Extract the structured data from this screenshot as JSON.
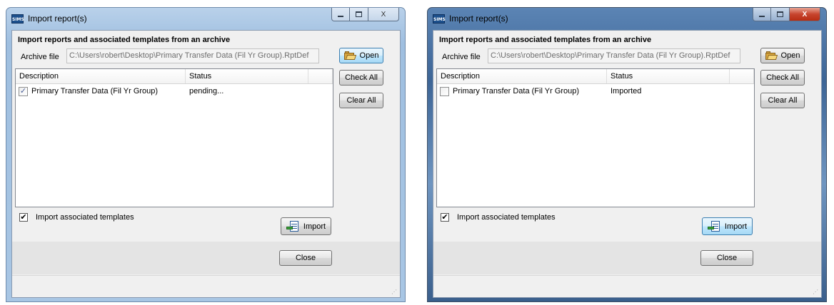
{
  "dialogs": [
    {
      "title": "Import report(s)",
      "app_icon": "SIMS",
      "heading": "Import reports and associated templates from an archive",
      "archive_label": "Archive file",
      "archive_path": "C:\\Users\\robert\\Desktop\\Primary Transfer Data (Fil Yr Group).RptDef",
      "open_label": "Open",
      "check_all_label": "Check All",
      "clear_all_label": "Clear All",
      "columns": [
        "Description",
        "Status"
      ],
      "rows": [
        {
          "description": "Primary Transfer Data (Fil Yr Group)",
          "status": "pending...",
          "checked": true
        }
      ],
      "templates_label": "Import associated templates",
      "templates_checked": true,
      "import_label": "Import",
      "close_label": "Close"
    },
    {
      "title": "Import report(s)",
      "app_icon": "SIMS",
      "heading": "Import reports and associated templates from an archive",
      "archive_label": "Archive file",
      "archive_path": "C:\\Users\\robert\\Desktop\\Primary Transfer Data (Fil Yr Group).RptDef",
      "open_label": "Open",
      "check_all_label": "Check All",
      "clear_all_label": "Clear All",
      "columns": [
        "Description",
        "Status"
      ],
      "rows": [
        {
          "description": "Primary Transfer Data (Fil Yr Group)",
          "status": "Imported",
          "checked": false
        }
      ],
      "templates_label": "Import associated templates",
      "templates_checked": true,
      "import_label": "Import",
      "close_label": "Close"
    }
  ],
  "glyphs": {
    "check": "✓",
    "tick": "✔",
    "close_x": "X",
    "grip": "⋰"
  },
  "colors": {
    "accent_focus": "#3c7fb1",
    "close_button_red": "#c7442d",
    "folder": "#d8a53d"
  }
}
